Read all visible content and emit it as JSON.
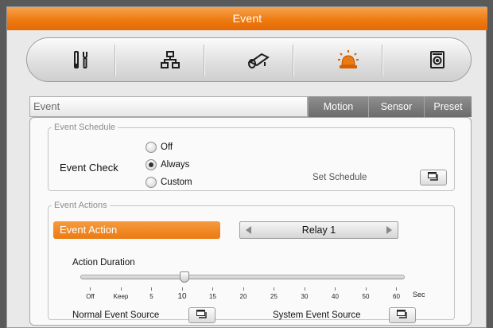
{
  "window": {
    "title": "Event"
  },
  "toolbar": {
    "items": [
      {
        "icon": "tools-icon",
        "label": ""
      },
      {
        "icon": "network-icon",
        "label": ""
      },
      {
        "icon": "camera-icon",
        "label": ""
      },
      {
        "icon": "alarm-icon",
        "label": ""
      },
      {
        "icon": "storage-icon",
        "label": ""
      }
    ],
    "active_index": 3,
    "active_color": "#e46a05"
  },
  "header": {
    "breadcrumb": "Event",
    "tabs": [
      "Motion",
      "Sensor",
      "Preset"
    ]
  },
  "schedule": {
    "legend": "Event Schedule",
    "check_label": "Event Check",
    "options": [
      "Off",
      "Always",
      "Custom"
    ],
    "selected": "Always",
    "set_schedule_label": "Set Schedule"
  },
  "actions": {
    "legend": "Event Actions",
    "event_action_label": "Event Action",
    "relay_value": "Relay 1",
    "duration_label": "Action Duration",
    "duration_value": "10",
    "tick_labels": [
      "Off",
      "Keep",
      "5",
      "10",
      "15",
      "20",
      "25",
      "30",
      "40",
      "50",
      "60"
    ],
    "unit": "Sec",
    "normal_source_label": "Normal Event Source",
    "system_source_label": "System Event Source"
  },
  "colors": {
    "accent": "#ee7b12",
    "tab_bg": "#7a7a7a"
  }
}
